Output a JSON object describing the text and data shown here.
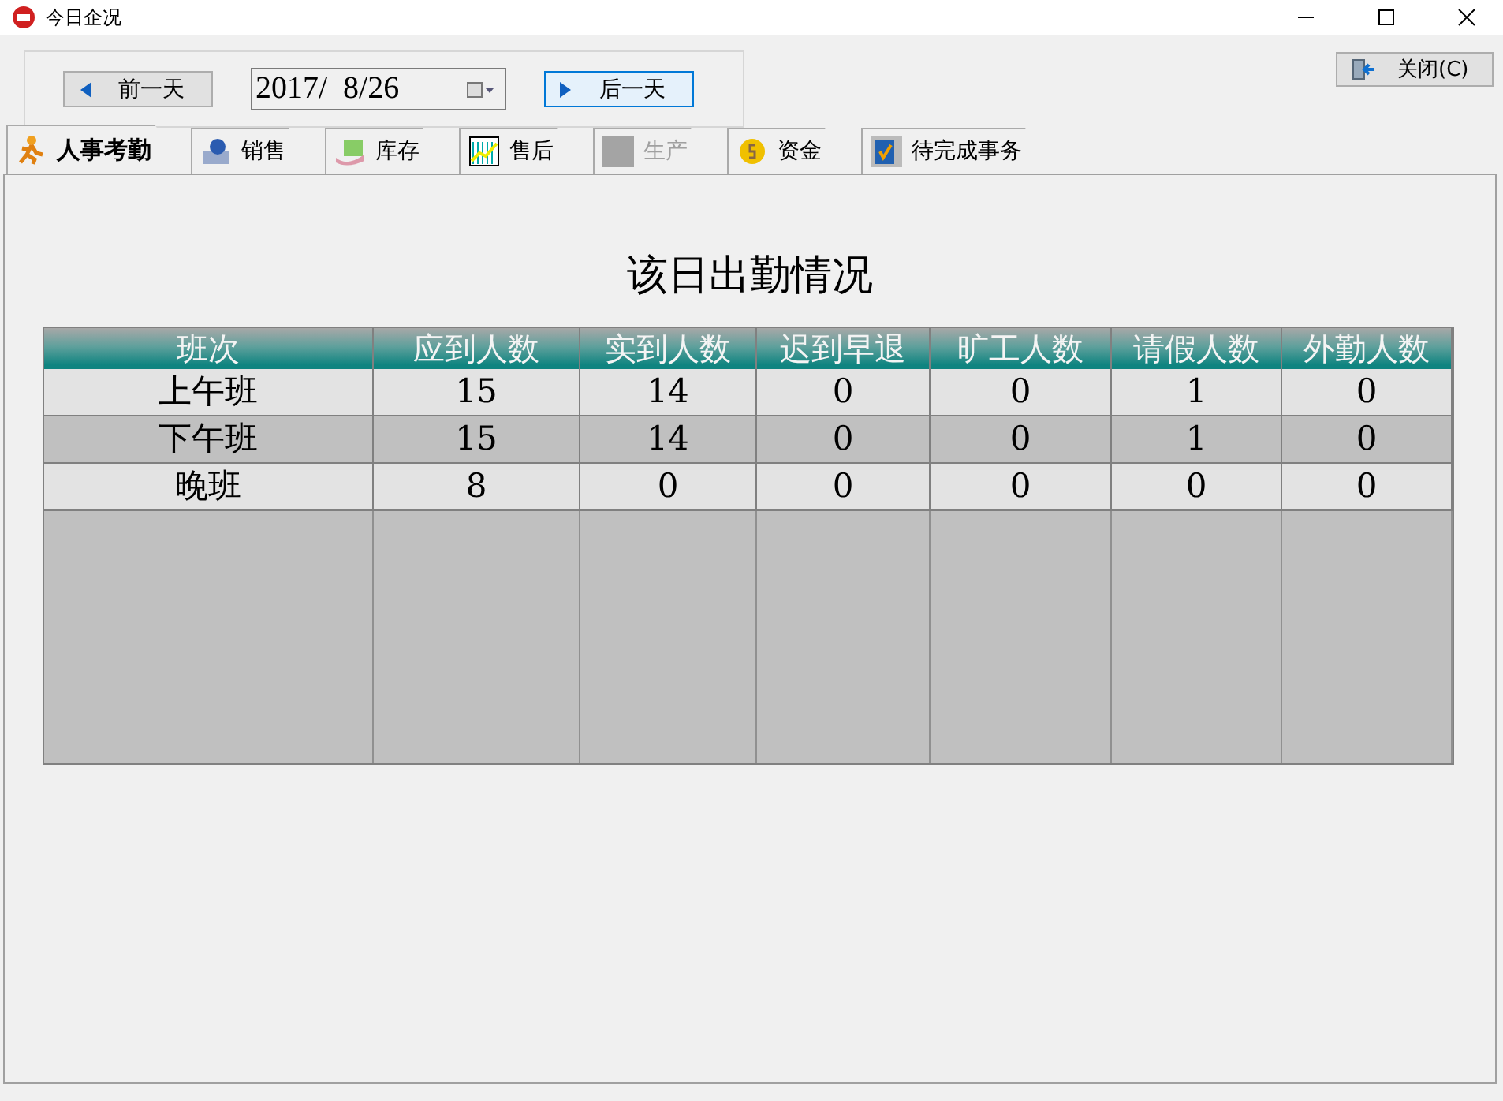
{
  "window": {
    "title": "今日企况"
  },
  "toolbar": {
    "prev_button": "前一天",
    "date": "2017/  8/26",
    "next_button": "后一天"
  },
  "close_button": "关闭(C)",
  "tabs": [
    {
      "label": "人事考勤",
      "selected": true,
      "disabled": false
    },
    {
      "label": "销售",
      "selected": false,
      "disabled": false
    },
    {
      "label": "库存",
      "selected": false,
      "disabled": false
    },
    {
      "label": "售后",
      "selected": false,
      "disabled": false
    },
    {
      "label": "生产",
      "selected": false,
      "disabled": true
    },
    {
      "label": "资金",
      "selected": false,
      "disabled": false
    },
    {
      "label": "待完成事务",
      "selected": false,
      "disabled": false
    }
  ],
  "panel": {
    "title": "该日出勤情况",
    "table": {
      "columns": [
        "班次",
        "应到人数",
        "实到人数",
        "迟到早退",
        "旷工人数",
        "请假人数",
        "外勤人数"
      ],
      "rows": [
        [
          "上午班",
          "15",
          "14",
          "0",
          "0",
          "1",
          "0"
        ],
        [
          "下午班",
          "15",
          "14",
          "0",
          "0",
          "1",
          "0"
        ],
        [
          "晚班",
          "8",
          "0",
          "0",
          "0",
          "0",
          "0"
        ]
      ]
    }
  }
}
